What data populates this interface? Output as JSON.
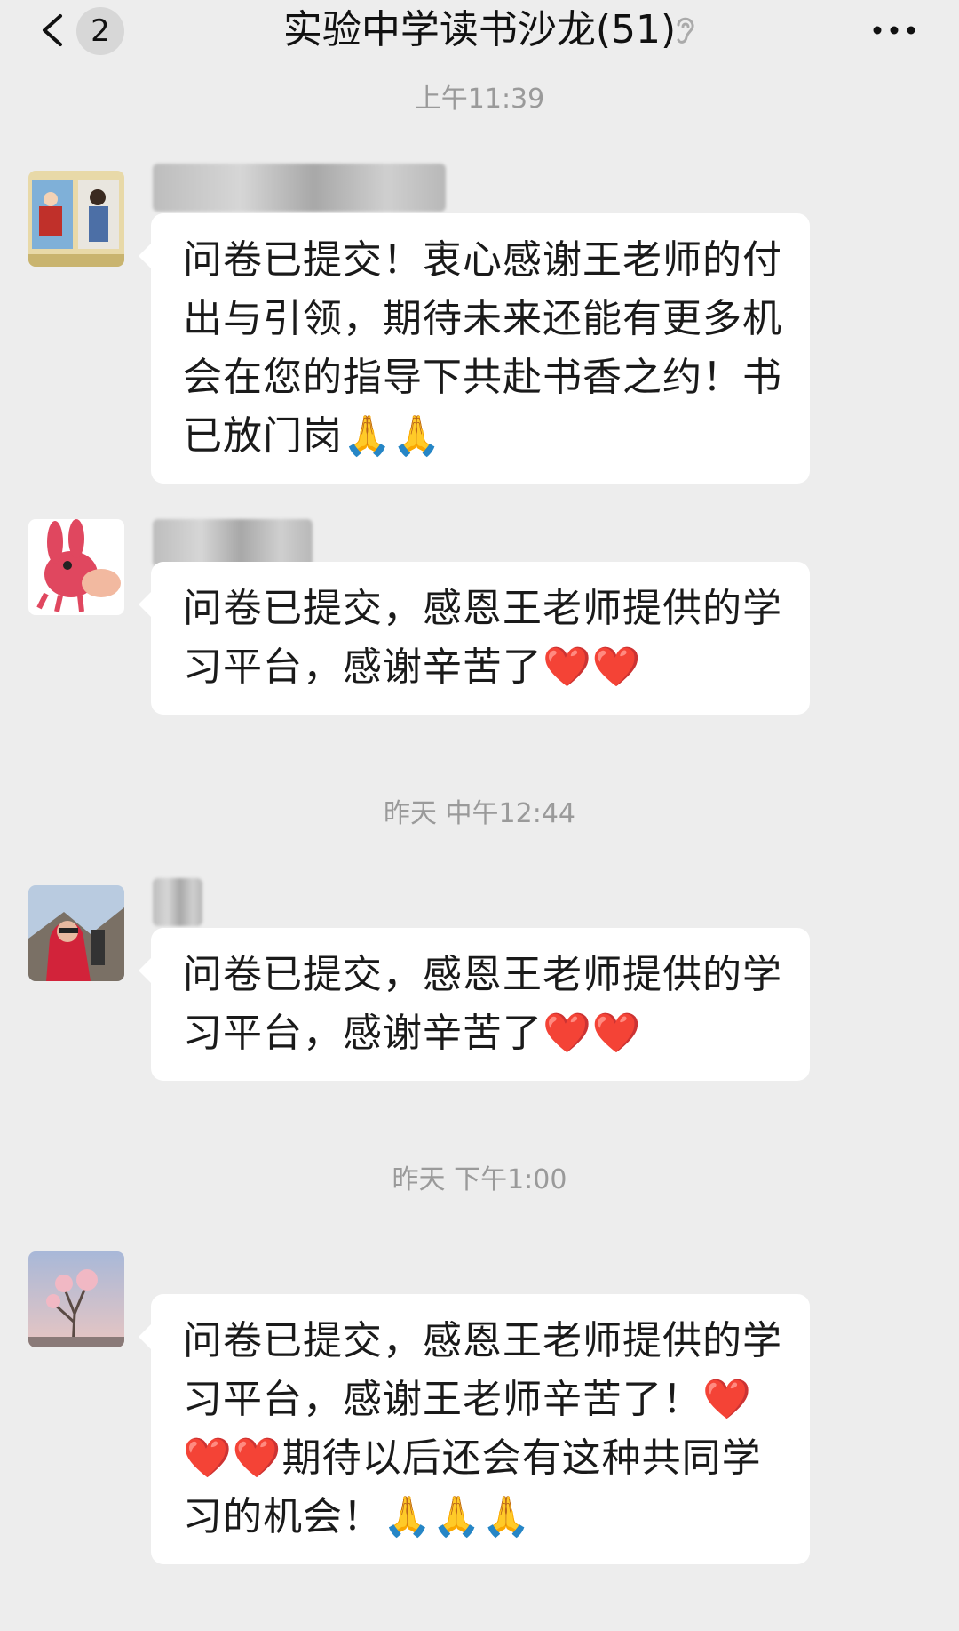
{
  "header": {
    "title": "实验中学读书沙龙(51)",
    "unread_count": "2",
    "back_icon": "chevron-left-icon",
    "mute_icon": "ear-mute-icon",
    "more_icon": "ellipsis-icon"
  },
  "timestamps": [
    "上午11:39",
    "昨天 中午12:44",
    "昨天 下午1:00"
  ],
  "messages": [
    {
      "text": "问卷已提交！衷心感谢王老师的付出与引领，期待未来还能有更多机会在您的指导下共赴书香之约！书已放门岗🙏🙏"
    },
    {
      "text": "问卷已提交，感恩王老师提供的学习平台，感谢辛苦了❤️❤️"
    },
    {
      "text": "问卷已提交，感恩王老师提供的学习平台，感谢辛苦了❤️❤️"
    },
    {
      "text": "问卷已提交，感恩王老师提供的学习平台，感谢王老师辛苦了！❤️❤️❤️期待以后还会有这种共同学习的机会！🙏🙏🙏"
    }
  ],
  "colors": {
    "background": "#ededed",
    "bubble": "#ffffff",
    "timestamp_text": "#9a9a9a"
  }
}
